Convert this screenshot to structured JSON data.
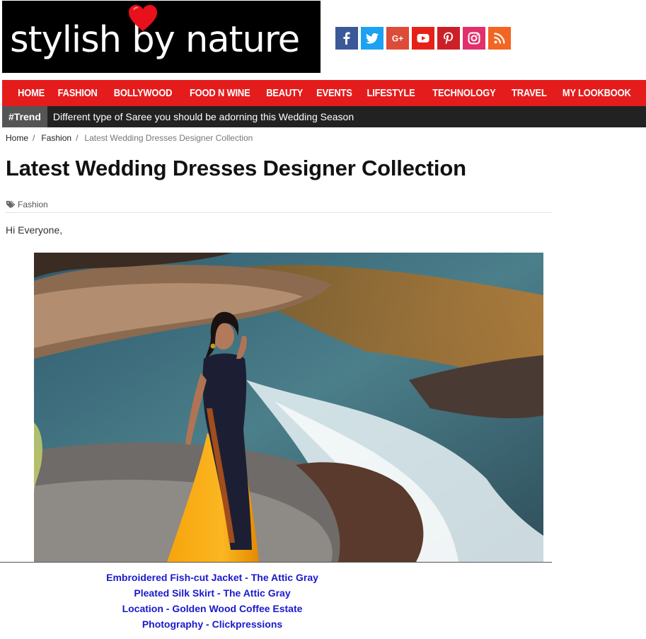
{
  "site": {
    "logo_text": "stylish by nature"
  },
  "social": [
    {
      "name": "facebook-icon",
      "color": "#3b5998"
    },
    {
      "name": "twitter-icon",
      "color": "#1da1f2"
    },
    {
      "name": "google-plus-icon",
      "color": "#dd4b39",
      "label": "G+"
    },
    {
      "name": "youtube-icon",
      "color": "#e62117"
    },
    {
      "name": "pinterest-icon",
      "color": "#cb2027"
    },
    {
      "name": "instagram-icon",
      "color": "#e1306c"
    },
    {
      "name": "rss-icon",
      "color": "#f26522"
    }
  ],
  "nav": {
    "items": [
      "HOME",
      "FASHION",
      "BOLLYWOOD",
      "FOOD N WINE",
      "BEAUTY",
      "EVENTS",
      "LIFESTYLE",
      "TECHNOLOGY",
      "TRAVEL",
      "MY LOOKBOOK"
    ]
  },
  "trend": {
    "tag": "#Trend",
    "text": "Different type of Saree you should be adorning this Wedding Season"
  },
  "breadcrumb": {
    "home": "Home",
    "section": "Fashion",
    "current": "Latest Wedding Dresses Designer Collection",
    "separator": "/"
  },
  "article": {
    "title": "Latest Wedding Dresses Designer Collection",
    "category": "Fashion",
    "greeting": "Hi Everyone,"
  },
  "credits": [
    "Embroidered Fish-cut Jacket - The Attic Gray",
    "Pleated Silk Skirt - The Attic Gray",
    "Location - Golden Wood Coffee Estate",
    "Photography - Clickpressions"
  ],
  "colors": {
    "nav_bg": "#e41c1c",
    "trend_bg": "#222222",
    "link": "#1a1acc"
  }
}
